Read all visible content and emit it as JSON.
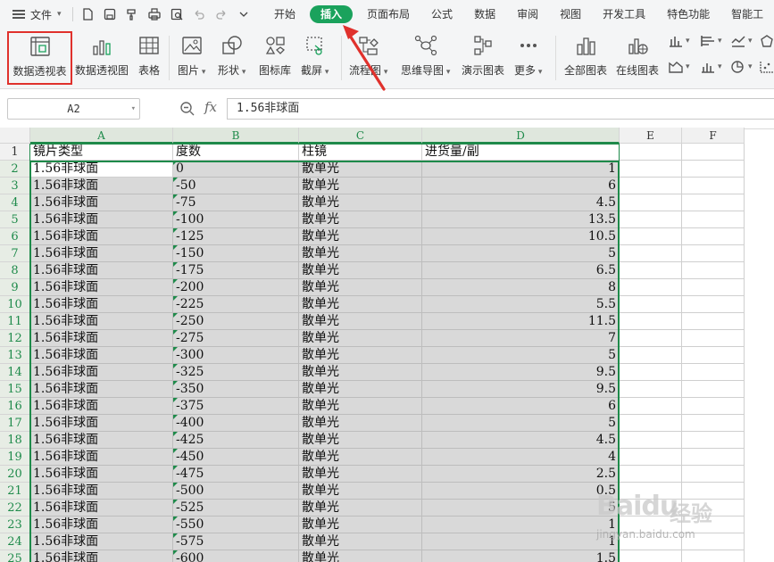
{
  "menubar": {
    "file_label": "文件",
    "tabs": [
      {
        "label": "开始"
      },
      {
        "label": "插入",
        "active": true
      },
      {
        "label": "页面布局"
      },
      {
        "label": "公式"
      },
      {
        "label": "数据"
      },
      {
        "label": "审阅"
      },
      {
        "label": "视图"
      },
      {
        "label": "开发工具"
      },
      {
        "label": "特色功能"
      },
      {
        "label": "智能工"
      }
    ]
  },
  "ribbon": {
    "pivot_table": "数据透视表",
    "pivot_chart": "数据透视图",
    "table": "表格",
    "picture": "图片",
    "shape": "形状",
    "icon_lib": "图标库",
    "screenshot": "截屏",
    "flowchart": "流程图",
    "mindmap": "思维导图",
    "demo_chart": "演示图表",
    "more": "更多",
    "all_charts": "全部图表",
    "online_chart": "在线图表"
  },
  "formula_bar": {
    "cell_ref": "A2",
    "fx": "fx",
    "formula": "1.56非球面"
  },
  "sheet": {
    "columns": [
      "A",
      "B",
      "C",
      "D",
      "E",
      "F"
    ],
    "header_row": [
      "镜片类型",
      "度数",
      "柱镜",
      "进货量/副"
    ],
    "rows": [
      [
        "1.56非球面",
        "0",
        "散单光",
        "1"
      ],
      [
        "1.56非球面",
        "-50",
        "散单光",
        "6"
      ],
      [
        "1.56非球面",
        "-75",
        "散单光",
        "4.5"
      ],
      [
        "1.56非球面",
        "-100",
        "散单光",
        "13.5"
      ],
      [
        "1.56非球面",
        "-125",
        "散单光",
        "10.5"
      ],
      [
        "1.56非球面",
        "-150",
        "散单光",
        "5"
      ],
      [
        "1.56非球面",
        "-175",
        "散单光",
        "6.5"
      ],
      [
        "1.56非球面",
        "-200",
        "散单光",
        "8"
      ],
      [
        "1.56非球面",
        "-225",
        "散单光",
        "5.5"
      ],
      [
        "1.56非球面",
        "-250",
        "散单光",
        "11.5"
      ],
      [
        "1.56非球面",
        "-275",
        "散单光",
        "7"
      ],
      [
        "1.56非球面",
        "-300",
        "散单光",
        "5"
      ],
      [
        "1.56非球面",
        "-325",
        "散单光",
        "9.5"
      ],
      [
        "1.56非球面",
        "-350",
        "散单光",
        "9.5"
      ],
      [
        "1.56非球面",
        "-375",
        "散单光",
        "6"
      ],
      [
        "1.56非球面",
        "-400",
        "散单光",
        "5"
      ],
      [
        "1.56非球面",
        "-425",
        "散单光",
        "4.5"
      ],
      [
        "1.56非球面",
        "-450",
        "散单光",
        "4"
      ],
      [
        "1.56非球面",
        "-475",
        "散单光",
        "2.5"
      ],
      [
        "1.56非球面",
        "-500",
        "散单光",
        "0.5"
      ],
      [
        "1.56非球面",
        "-525",
        "散单光",
        "5"
      ],
      [
        "1.56非球面",
        "-550",
        "散单光",
        "1"
      ],
      [
        "1.56非球面",
        "-575",
        "散单光",
        "1"
      ],
      [
        "1.56非球面",
        "-600",
        "散单光",
        "1.5"
      ]
    ]
  },
  "watermark": {
    "brand": "Baidu",
    "brand_cn": "经验",
    "url": "jingyan.baidu.com"
  },
  "colors": {
    "accent_green": "#1aa25c",
    "selection_green": "#1e8a4a",
    "highlight_red": "#e0312c"
  }
}
